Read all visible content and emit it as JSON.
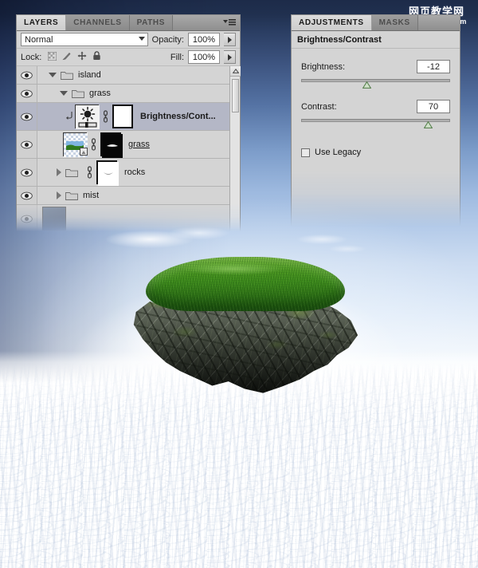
{
  "watermark": {
    "chinese": "网页教学网",
    "url": "www.webjx.com"
  },
  "layers_panel": {
    "tabs": [
      {
        "label": "LAYERS",
        "active": true
      },
      {
        "label": "CHANNELS",
        "active": false
      },
      {
        "label": "PATHS",
        "active": false
      }
    ],
    "menu_icon": "panel-menu-icon",
    "blend_mode": "Normal",
    "opacity_label": "Opacity:",
    "opacity_value": "100%",
    "lock_label": "Lock:",
    "lock_icons": [
      "lock-transparency-icon",
      "lock-image-icon",
      "lock-position-icon",
      "lock-all-icon"
    ],
    "fill_label": "Fill:",
    "fill_value": "100%",
    "rows": [
      {
        "name": "island",
        "type": "group",
        "expanded": true,
        "indent": 0,
        "visible": true,
        "selected": false
      },
      {
        "name": "grass",
        "type": "group",
        "expanded": true,
        "indent": 1,
        "visible": true,
        "selected": false
      },
      {
        "name": "Brightness/Cont...",
        "type": "adjustment",
        "indent": 2,
        "visible": true,
        "selected": true,
        "clipped": true,
        "thumb": "brightness-contrast-icon",
        "mask": "white-mask"
      },
      {
        "name": "grass",
        "type": "pixel",
        "indent": 2,
        "visible": true,
        "selected": false,
        "underlined": true,
        "thumb": "grass-image-thumb",
        "mask": "black-mask"
      },
      {
        "name": "rocks",
        "type": "group",
        "expanded": false,
        "indent": 1,
        "visible": true,
        "selected": false,
        "mask": "white-mask"
      },
      {
        "name": "mist",
        "type": "group",
        "expanded": false,
        "indent": 1,
        "visible": true,
        "selected": false
      }
    ]
  },
  "adjustments_panel": {
    "tabs": [
      {
        "label": "ADJUSTMENTS",
        "active": true
      },
      {
        "label": "MASKS",
        "active": false
      }
    ],
    "title": "Brightness/Contrast",
    "brightness_label": "Brightness:",
    "brightness_value": "-12",
    "brightness_pct": 44,
    "contrast_label": "Contrast:",
    "contrast_value": "70",
    "contrast_pct": 85,
    "use_legacy_label": "Use Legacy",
    "use_legacy_checked": false
  },
  "canvas": {
    "subject": "floating grass-topped rock island above a sea of clouds",
    "sky_top_color": "#1d2b49",
    "sky_mid_color": "#7d9dca",
    "cloud_color": "#ffffff",
    "grass_color": "#3d8a1c",
    "rock_color": "#4a5145"
  }
}
